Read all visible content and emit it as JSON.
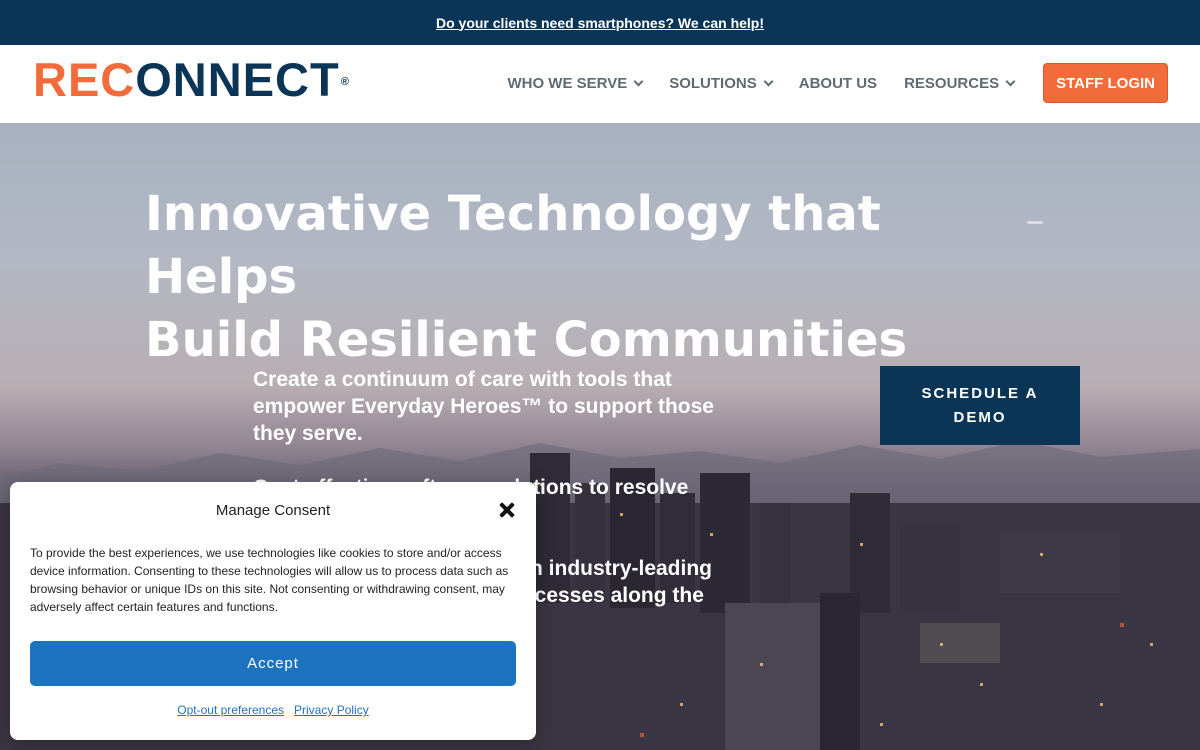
{
  "topbar": {
    "announcement": "Do your clients need smartphones? We can help!"
  },
  "header": {
    "logo": {
      "part1": "RE",
      "part2": "C",
      "part3": "ONNECT",
      "registered": "®"
    },
    "nav": [
      {
        "label": "WHO WE SERVE",
        "has_dropdown": true
      },
      {
        "label": "SOLUTIONS",
        "has_dropdown": true
      },
      {
        "label": "ABOUT US",
        "has_dropdown": false
      },
      {
        "label": "RESOURCES",
        "has_dropdown": true
      }
    ],
    "staff_login": "STAFF LOGIN"
  },
  "hero": {
    "title_line1": "Innovative Technology that Helps",
    "title_line2": "Build Resilient Communities",
    "paragraphs": [
      "Create a continuum of care with tools that empower Everyday Heroes™ to support those they serve.",
      "Cost-effective software solutions to resolve unique",
      "th industry-leading ccesses along the"
    ],
    "demo_button": "SCHEDULE A DEMO"
  },
  "consent": {
    "title": "Manage Consent",
    "body": "To provide the best experiences, we use technologies like cookies to store and/or access device information. Consenting to these technologies will allow us to process data such as browsing behavior or unique IDs on this site. Not consenting or withdrawing consent, may adversely affect certain features and functions.",
    "accept": "Accept",
    "links": [
      "Opt-out preferences",
      "Privacy Policy"
    ]
  },
  "colors": {
    "navy": "#0b3556",
    "orange": "#f26b3a",
    "blue": "#1e73be"
  }
}
